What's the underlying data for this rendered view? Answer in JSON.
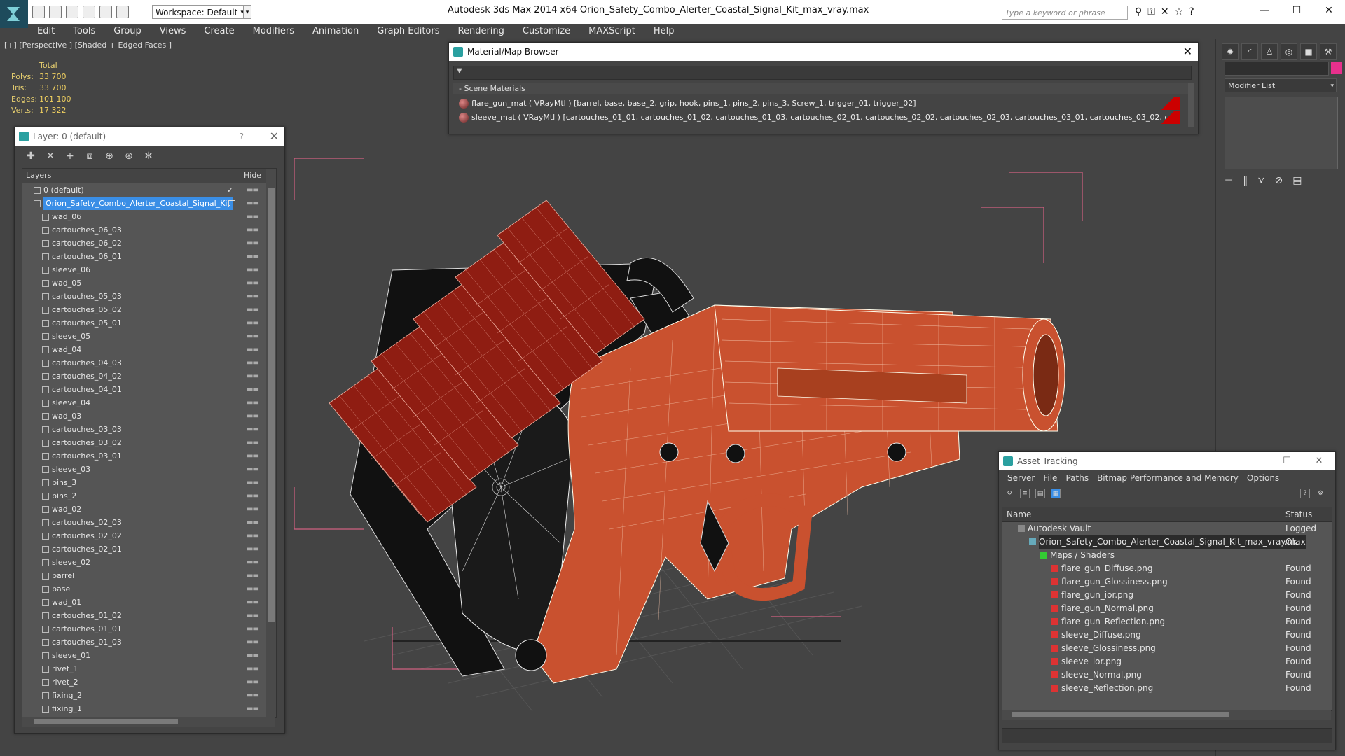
{
  "titlebar": {
    "workspace": "Workspace: Default",
    "app_title": "Autodesk 3ds Max  2014 x64      Orion_Safety_Combo_Alerter_Coastal_Signal_Kit_max_vray.max",
    "search_placeholder": "Type a keyword or phrase"
  },
  "menu": [
    "Edit",
    "Tools",
    "Group",
    "Views",
    "Create",
    "Modifiers",
    "Animation",
    "Graph Editors",
    "Rendering",
    "Customize",
    "MAXScript",
    "Help"
  ],
  "viewport": {
    "label": "[+] [Perspective ] [Shaded + Edged Faces ]",
    "stats": {
      "total": "Total",
      "rows": [
        {
          "label": "Polys:",
          "value": "33 700"
        },
        {
          "label": "Tris:",
          "value": "33 700"
        },
        {
          "label": "Edges:",
          "value": "101 100"
        },
        {
          "label": "Verts:",
          "value": "17 322"
        }
      ]
    }
  },
  "layer_dialog": {
    "title": "Layer: 0 (default)",
    "help": "?",
    "col_layers": "Layers",
    "col_hide": "Hide",
    "rows": [
      {
        "name": "0 (default)",
        "level": 0,
        "checked": true
      },
      {
        "name": "Orion_Safety_Combo_Alerter_Coastal_Signal_Kit",
        "level": 0,
        "selected": true
      },
      {
        "name": "wad_06",
        "level": 1
      },
      {
        "name": "cartouches_06_03",
        "level": 1
      },
      {
        "name": "cartouches_06_02",
        "level": 1
      },
      {
        "name": "cartouches_06_01",
        "level": 1
      },
      {
        "name": "sleeve_06",
        "level": 1
      },
      {
        "name": "wad_05",
        "level": 1
      },
      {
        "name": "cartouches_05_03",
        "level": 1
      },
      {
        "name": "cartouches_05_02",
        "level": 1
      },
      {
        "name": "cartouches_05_01",
        "level": 1
      },
      {
        "name": "sleeve_05",
        "level": 1
      },
      {
        "name": "wad_04",
        "level": 1
      },
      {
        "name": "cartouches_04_03",
        "level": 1
      },
      {
        "name": "cartouches_04_02",
        "level": 1
      },
      {
        "name": "cartouches_04_01",
        "level": 1
      },
      {
        "name": "sleeve_04",
        "level": 1
      },
      {
        "name": "wad_03",
        "level": 1
      },
      {
        "name": "cartouches_03_03",
        "level": 1
      },
      {
        "name": "cartouches_03_02",
        "level": 1
      },
      {
        "name": "cartouches_03_01",
        "level": 1
      },
      {
        "name": "sleeve_03",
        "level": 1
      },
      {
        "name": "pins_3",
        "level": 1
      },
      {
        "name": "pins_2",
        "level": 1
      },
      {
        "name": "wad_02",
        "level": 1
      },
      {
        "name": "cartouches_02_03",
        "level": 1
      },
      {
        "name": "cartouches_02_02",
        "level": 1
      },
      {
        "name": "cartouches_02_01",
        "level": 1
      },
      {
        "name": "sleeve_02",
        "level": 1
      },
      {
        "name": "barrel",
        "level": 1
      },
      {
        "name": "base",
        "level": 1
      },
      {
        "name": "wad_01",
        "level": 1
      },
      {
        "name": "cartouches_01_02",
        "level": 1
      },
      {
        "name": "cartouches_01_01",
        "level": 1
      },
      {
        "name": "cartouches_01_03",
        "level": 1
      },
      {
        "name": "sleeve_01",
        "level": 1
      },
      {
        "name": "rivet_1",
        "level": 1
      },
      {
        "name": "rivet_2",
        "level": 1
      },
      {
        "name": "fixing_2",
        "level": 1
      },
      {
        "name": "fixing_1",
        "level": 1
      }
    ]
  },
  "material_browser": {
    "title": "Material/Map Browser",
    "section": "- Scene Materials",
    "rows": [
      "flare_gun_mat  ( VRayMtl )  [barrel, base, base_2, grip, hook, pins_1, pins_2, pins_3, Screw_1, trigger_01, trigger_02]",
      "sleeve_mat  ( VRayMtl )  [cartouches_01_01, cartouches_01_02, cartouches_01_03, cartouches_02_01, cartouches_02_02, cartouches_02_03, cartouches_03_01, cartouches_03_02, cartouches_03_..."
    ]
  },
  "command_panel": {
    "modifier_list": "Modifier List",
    "color": "#e8308c"
  },
  "asset_tracking": {
    "title": "Asset Tracking",
    "menu": [
      "Server",
      "File",
      "Paths",
      "Bitmap Performance and Memory",
      "Options"
    ],
    "col_name": "Name",
    "col_status": "Status",
    "rows": [
      {
        "name": "Autodesk Vault",
        "status": "Logged Out",
        "level": 0,
        "icon": "vault"
      },
      {
        "name": "Orion_Safety_Combo_Alerter_Coastal_Signal_Kit_max_vray.max",
        "status": "Ok",
        "level": 1,
        "icon": "file",
        "selected": true
      },
      {
        "name": "Maps / Shaders",
        "status": "",
        "level": 2,
        "icon": "folder"
      },
      {
        "name": "flare_gun_Diffuse.png",
        "status": "Found",
        "level": 3,
        "icon": "png"
      },
      {
        "name": "flare_gun_Glossiness.png",
        "status": "Found",
        "level": 3,
        "icon": "png"
      },
      {
        "name": "flare_gun_ior.png",
        "status": "Found",
        "level": 3,
        "icon": "png"
      },
      {
        "name": "flare_gun_Normal.png",
        "status": "Found",
        "level": 3,
        "icon": "png"
      },
      {
        "name": "flare_gun_Reflection.png",
        "status": "Found",
        "level": 3,
        "icon": "png"
      },
      {
        "name": "sleeve_Diffuse.png",
        "status": "Found",
        "level": 3,
        "icon": "png"
      },
      {
        "name": "sleeve_Glossiness.png",
        "status": "Found",
        "level": 3,
        "icon": "png"
      },
      {
        "name": "sleeve_ior.png",
        "status": "Found",
        "level": 3,
        "icon": "png"
      },
      {
        "name": "sleeve_Normal.png",
        "status": "Found",
        "level": 3,
        "icon": "png"
      },
      {
        "name": "sleeve_Reflection.png",
        "status": "Found",
        "level": 3,
        "icon": "png"
      }
    ]
  },
  "colors": {
    "model_orange": "#c9512f",
    "sleeve_red": "#8f1d12",
    "selection_blue": "#3a8ee6"
  }
}
